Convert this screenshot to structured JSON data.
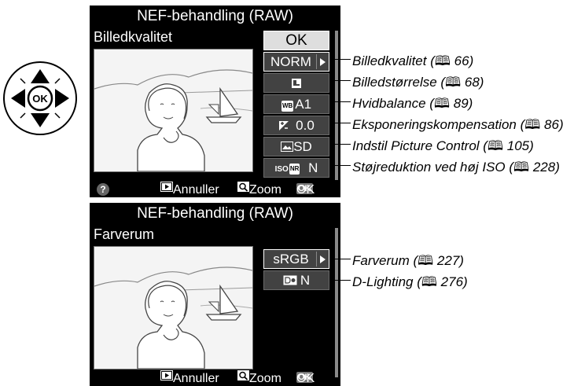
{
  "multi_selector": {
    "center_label": "OK"
  },
  "screen1": {
    "title": "NEF-behandling (RAW)",
    "subtitle": "Billedkvalitet",
    "ok_label": "OK",
    "buttons": [
      {
        "label": "NORM",
        "icon": ""
      },
      {
        "label": "",
        "icon": "image-size-icon"
      },
      {
        "label": "A1",
        "icon": "wb-icon",
        "icon_text": "WB"
      },
      {
        "label": "0.0",
        "icon": "exposure-compensation-icon"
      },
      {
        "label": "SD",
        "icon": "picture-control-icon"
      },
      {
        "label": "N",
        "icon": "iso-nr-icon",
        "icon_text": "ISO NR"
      }
    ],
    "footer": {
      "help": "?",
      "cancel_label": "Annuller",
      "zoom_label": "Zoom",
      "ok_label": "OK",
      "ok_key": "OK"
    }
  },
  "screen2": {
    "title": "NEF-behandling (RAW)",
    "subtitle": "Farverum",
    "buttons": [
      {
        "label": "sRGB",
        "icon": ""
      },
      {
        "label": "N",
        "icon": "d-lighting-icon"
      }
    ],
    "footer": {
      "cancel_label": "Annuller",
      "zoom_label": "Zoom",
      "ok_label": "OK",
      "ok_key": "OK"
    }
  },
  "annotations1": [
    {
      "text": "Billedkvalitet (",
      "page": "66"
    },
    {
      "text": "Billedstørrelse (",
      "page": "68"
    },
    {
      "text": "Hvidbalance (",
      "page": "89"
    },
    {
      "text": "Eksponeringskompensation (",
      "page": "86"
    },
    {
      "text": "Indstil Picture Control (",
      "page": "105"
    },
    {
      "text": "Støjreduktion ved høj ISO (",
      "page": "228"
    }
  ],
  "annotations2": [
    {
      "text": "Farverum (",
      "page": "227"
    },
    {
      "text": "D-Lighting (",
      "page": "276"
    }
  ],
  "book_icon": "book-icon"
}
